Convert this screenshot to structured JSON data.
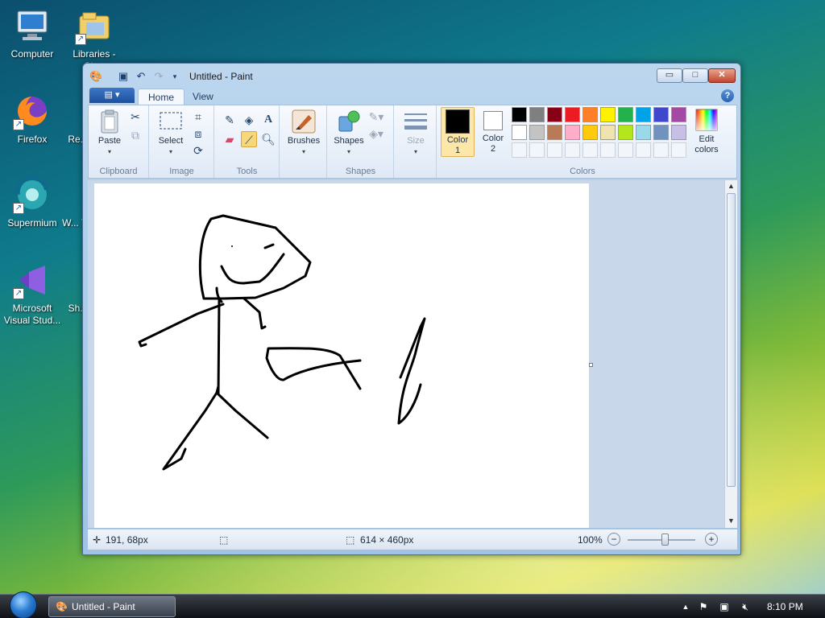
{
  "desktop": {
    "icons": [
      {
        "label": "Computer",
        "icon": "computer-icon"
      },
      {
        "label": "Libraries - Sh...",
        "icon": "libraries-icon"
      },
      {
        "label": "Firefox",
        "icon": "firefox-icon"
      },
      {
        "label": "Re...",
        "icon": "recycle-bin-icon"
      },
      {
        "label": "Supermium",
        "icon": "supermium-icon"
      },
      {
        "label": "W... T...",
        "icon": "app-icon"
      },
      {
        "label": "Microsoft Visual Stud...",
        "icon": "visual-studio-icon"
      },
      {
        "label": "Sh...",
        "icon": "app-icon"
      }
    ]
  },
  "window": {
    "title": "Untitled - Paint",
    "controls": {
      "minimize": "▭",
      "maximize": "□",
      "close": "✕"
    }
  },
  "ribbon": {
    "tabs": [
      "Home",
      "View"
    ],
    "active_tab": "Home",
    "help": "?",
    "groups": {
      "clipboard": {
        "label": "Clipboard",
        "paste": "Paste"
      },
      "image": {
        "label": "Image",
        "select": "Select"
      },
      "tools": {
        "label": "Tools"
      },
      "brushes": {
        "label": "",
        "brushes": "Brushes"
      },
      "shapes": {
        "label": "Shapes",
        "shapes": "Shapes"
      },
      "size": {
        "label": "",
        "size": "Size"
      },
      "colors": {
        "label": "Colors",
        "color1": "Color\n1",
        "color2": "Color\n2",
        "edit_colors": "Edit\ncolors",
        "color1_value": "#000000",
        "color2_value": "#ffffff",
        "palette_row1": [
          "#000000",
          "#7f7f7f",
          "#880015",
          "#ed1c24",
          "#ff7f27",
          "#fff200",
          "#22b14c",
          "#00a2e8",
          "#3f48cc",
          "#a349a4"
        ],
        "palette_row2": [
          "#ffffff",
          "#c3c3c3",
          "#b97a57",
          "#ffaec9",
          "#ffc90e",
          "#efe4b0",
          "#b5e61d",
          "#99d9ea",
          "#7092be",
          "#c8bfe7"
        ]
      }
    }
  },
  "statusbar": {
    "cursor_pos": "191, 68px",
    "selection": "",
    "canvas_size": "614 × 460px",
    "zoom": "100%",
    "zoom_level": 1.0
  },
  "taskbar": {
    "task_label": "Untitled - Paint",
    "clock": "8:10 PM"
  }
}
